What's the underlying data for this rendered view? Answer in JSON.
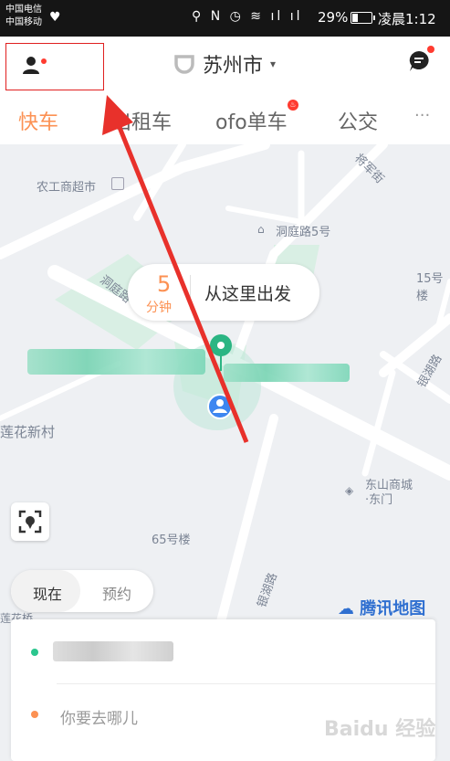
{
  "status_bar": {
    "carrier_1": "中国电信",
    "carrier_2": "中国移动",
    "icons": "⚲ N ◷ ≋ ıl ıl",
    "battery": "29%",
    "time": "凌晨1:12"
  },
  "header": {
    "city": "苏州市",
    "caret": "▾"
  },
  "tabs": [
    {
      "label": "快车",
      "active": true
    },
    {
      "label": "出租车",
      "active": false
    },
    {
      "label": "ofo单车",
      "active": false
    },
    {
      "label": "公交",
      "active": false
    }
  ],
  "tab_more": "···",
  "map": {
    "labels": {
      "supermarket": "农工商超市",
      "dongting5": "洞庭路5号",
      "dongting_road": "洞庭路",
      "jiangjun": "将军街",
      "no15": "15号楼",
      "yinhu": "银湖路",
      "lianhua": "莲花新村",
      "dongshan": "东山商城",
      "dongshan_gate": "·东门",
      "no65": "65号楼",
      "yinhu2": "银湖路",
      "bottom_left": "莲花桥"
    },
    "eta_number": "5",
    "eta_unit": "分钟",
    "pickup_text": "从这里出发",
    "brand": "腾讯地图"
  },
  "time_selector": {
    "now": "现在",
    "reserve": "预约"
  },
  "address": {
    "destination_placeholder": "你要去哪儿"
  },
  "watermark": "Baidu 经验",
  "colors": {
    "accent": "#fc9153",
    "origin_dot": "#2bc68e",
    "destination_dot": "#fc9153",
    "annotation": "#e02020"
  }
}
